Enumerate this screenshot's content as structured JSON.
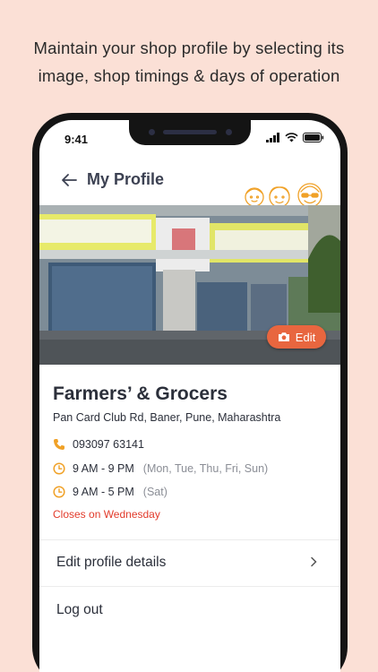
{
  "headline": {
    "line1": "Maintain your shop profile by selecting its",
    "line2": "image, shop timings & days of operation"
  },
  "status_bar": {
    "time": "9:41"
  },
  "header": {
    "title": "My Profile",
    "back_icon": "arrow-left-icon"
  },
  "banner": {
    "edit_label": "Edit",
    "edit_icon": "camera-icon"
  },
  "shop": {
    "name": "Farmers’ & Grocers",
    "address": "Pan Card Club Rd, Baner, Pune, Maharashtra",
    "phone": "093097 63141",
    "timings": [
      {
        "hours": "9 AM - 9 PM",
        "days": "(Mon, Tue, Thu, Fri, Sun)"
      },
      {
        "hours": "9 AM - 5 PM",
        "days": "(Sat)"
      }
    ],
    "closed_note": "Closes on Wednesday"
  },
  "menu": {
    "edit_profile": "Edit profile details",
    "logout": "Log out"
  },
  "colors": {
    "background": "#fbe0d6",
    "accent": "#e8663f",
    "icon_orange": "#f0a127",
    "alert_red": "#e23a2a"
  }
}
